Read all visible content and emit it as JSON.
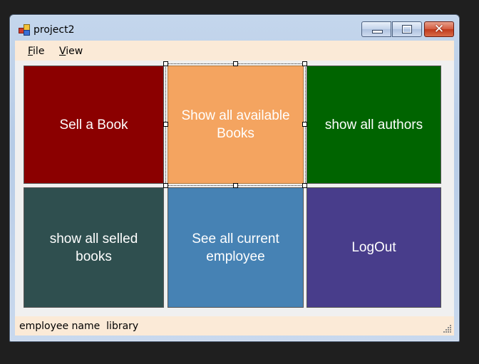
{
  "window": {
    "title": "project2",
    "controls": {
      "minimize": "minimize",
      "maximize": "maximize",
      "close": "close"
    }
  },
  "menu": {
    "items": [
      {
        "accel": "F",
        "rest": "ile"
      },
      {
        "accel": "V",
        "rest": "iew"
      }
    ]
  },
  "tiles": [
    {
      "label": "Sell a Book",
      "color": "#8b0000"
    },
    {
      "label": "Show all available\nBooks",
      "color": "#f4a460"
    },
    {
      "label": "show all authors",
      "color": "#006400"
    },
    {
      "label": "show all selled\nbooks",
      "color": "#2f4f4f"
    },
    {
      "label": "See all current\nemployee",
      "color": "#4682b4"
    },
    {
      "label": "LogOut",
      "color": "#483d8b"
    }
  ],
  "status": {
    "text": "employee name  library"
  },
  "colors": {
    "menubar": "#fbead7",
    "statusbar": "#fbead7",
    "client": "#f0f0f0"
  }
}
